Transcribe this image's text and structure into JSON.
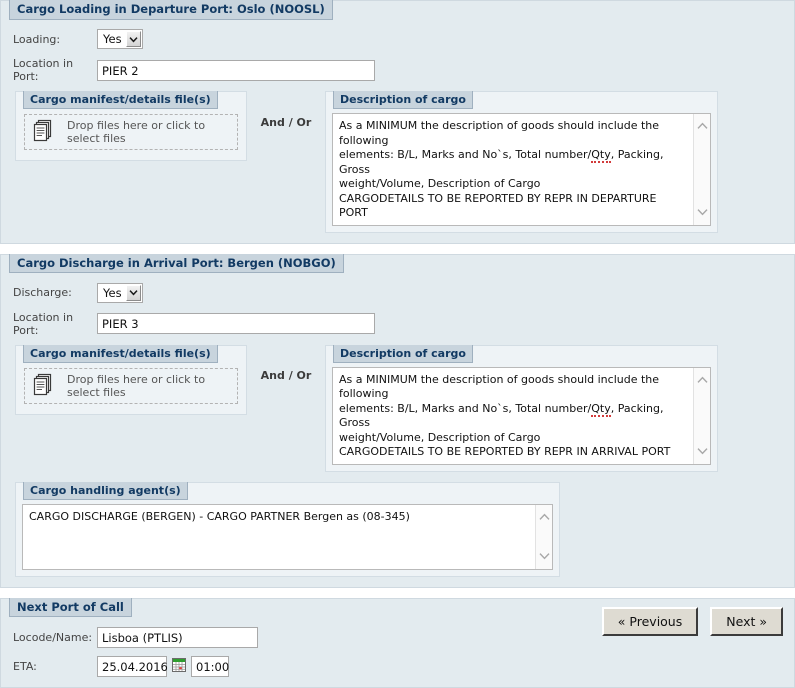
{
  "loading_section": {
    "legend": "Cargo Loading in Departure Port: Oslo (NOOSL)",
    "loading_label": "Loading:",
    "loading_value": "Yes",
    "location_label": "Location in Port:",
    "location_value": "PIER 2",
    "manifest_legend": "Cargo manifest/details file(s)",
    "dropzone_text": "Drop files here or click to select files",
    "dropzone_icon": "documents-icon",
    "and_or": "And / Or",
    "description_legend": "Description of cargo",
    "description_line1": "As a MINIMUM the description of goods should include the following",
    "description_line2a": "elements: B/L, Marks and No`s, Total number/",
    "description_line2b": "Qty",
    "description_line2c": ", Packing, Gross",
    "description_line3": "weight/Volume, Description of Cargo",
    "description_line4": "CARGODETAILS TO BE REPORTED BY REPR IN DEPARTURE PORT"
  },
  "discharge_section": {
    "legend": "Cargo Discharge in Arrival Port: Bergen (NOBGO)",
    "discharge_label": "Discharge:",
    "discharge_value": "Yes",
    "location_label": "Location in Port:",
    "location_value": "PIER 3",
    "manifest_legend": "Cargo manifest/details file(s)",
    "dropzone_text": "Drop files here or click to select files",
    "dropzone_icon": "documents-icon",
    "and_or": "And / Or",
    "description_legend": "Description of cargo",
    "description_line1": "As a MINIMUM the description of goods should include the following",
    "description_line2a": "elements: B/L, Marks and No`s, Total number/",
    "description_line2b": "Qty",
    "description_line2c": ", Packing, Gross",
    "description_line3": "weight/Volume, Description of Cargo",
    "description_line4": "CARGODETAILS TO BE REPORTED BY REPR IN ARRIVAL PORT",
    "agents_legend": "Cargo handling agent(s)",
    "agents_value": "CARGO DISCHARGE (BERGEN) - CARGO PARTNER Bergen as (08-345)"
  },
  "next_port_section": {
    "legend": "Next Port of Call",
    "locode_label": "Locode/Name:",
    "locode_value": "Lisboa (PTLIS)",
    "eta_label": "ETA:",
    "eta_date": "25.04.2016",
    "eta_time": "01:00",
    "calendar_icon": "calendar-icon"
  },
  "footer": {
    "previous_label": "« Previous",
    "next_label": "Next »"
  },
  "colors": {
    "panel_bg": "#e3ebef",
    "legend_bg": "#c8d4dd",
    "legend_text": "#123a63",
    "button_bg": "#dedbd2",
    "spellcheck_underline": "#d23b3b"
  }
}
